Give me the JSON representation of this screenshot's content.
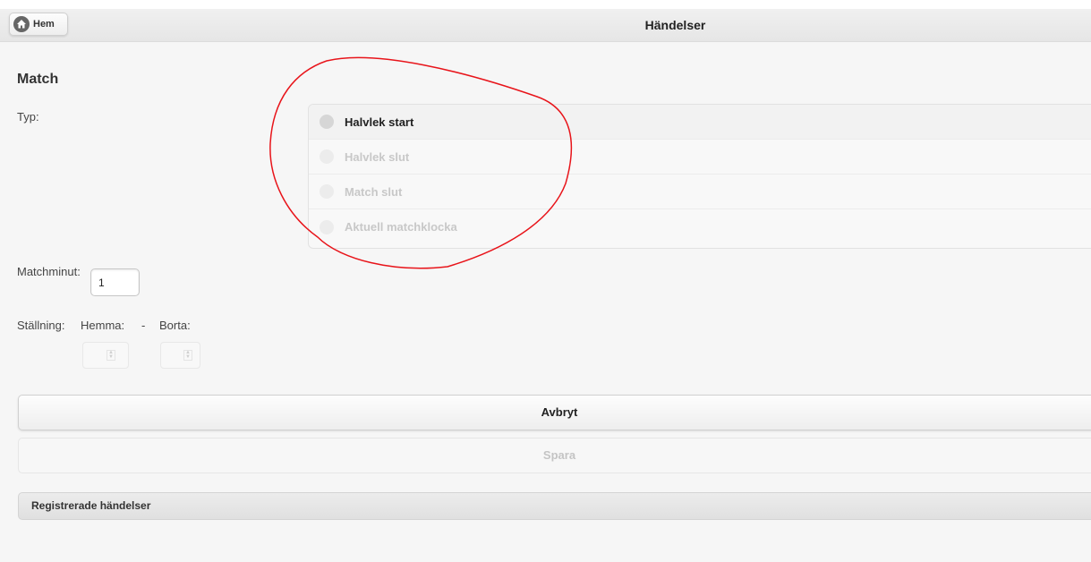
{
  "header": {
    "home_label": "Hem",
    "title": "Händelser"
  },
  "form": {
    "section_title": "Match",
    "type_label": "Typ:",
    "type_options": [
      {
        "label": "Halvlek start",
        "enabled": true,
        "selected": false
      },
      {
        "label": "Halvlek slut",
        "enabled": false,
        "selected": false
      },
      {
        "label": "Match slut",
        "enabled": false,
        "selected": false
      },
      {
        "label": "Aktuell matchklocka",
        "enabled": false,
        "selected": false
      }
    ],
    "minute_label": "Matchminut:",
    "minute_value": "1",
    "score_label": "Ställning:",
    "home_label": "Hemma:",
    "separator": "-",
    "away_label": "Borta:"
  },
  "buttons": {
    "cancel": "Avbryt",
    "save": "Spara"
  },
  "registered": {
    "label": "Registrerade händelser"
  },
  "colors": {
    "annotation": "#e8141a",
    "background": "#f6f6f6"
  },
  "icons": {
    "home": "home-icon",
    "radio": "radio-icon",
    "spinner": "spinner-arrows-icon"
  }
}
